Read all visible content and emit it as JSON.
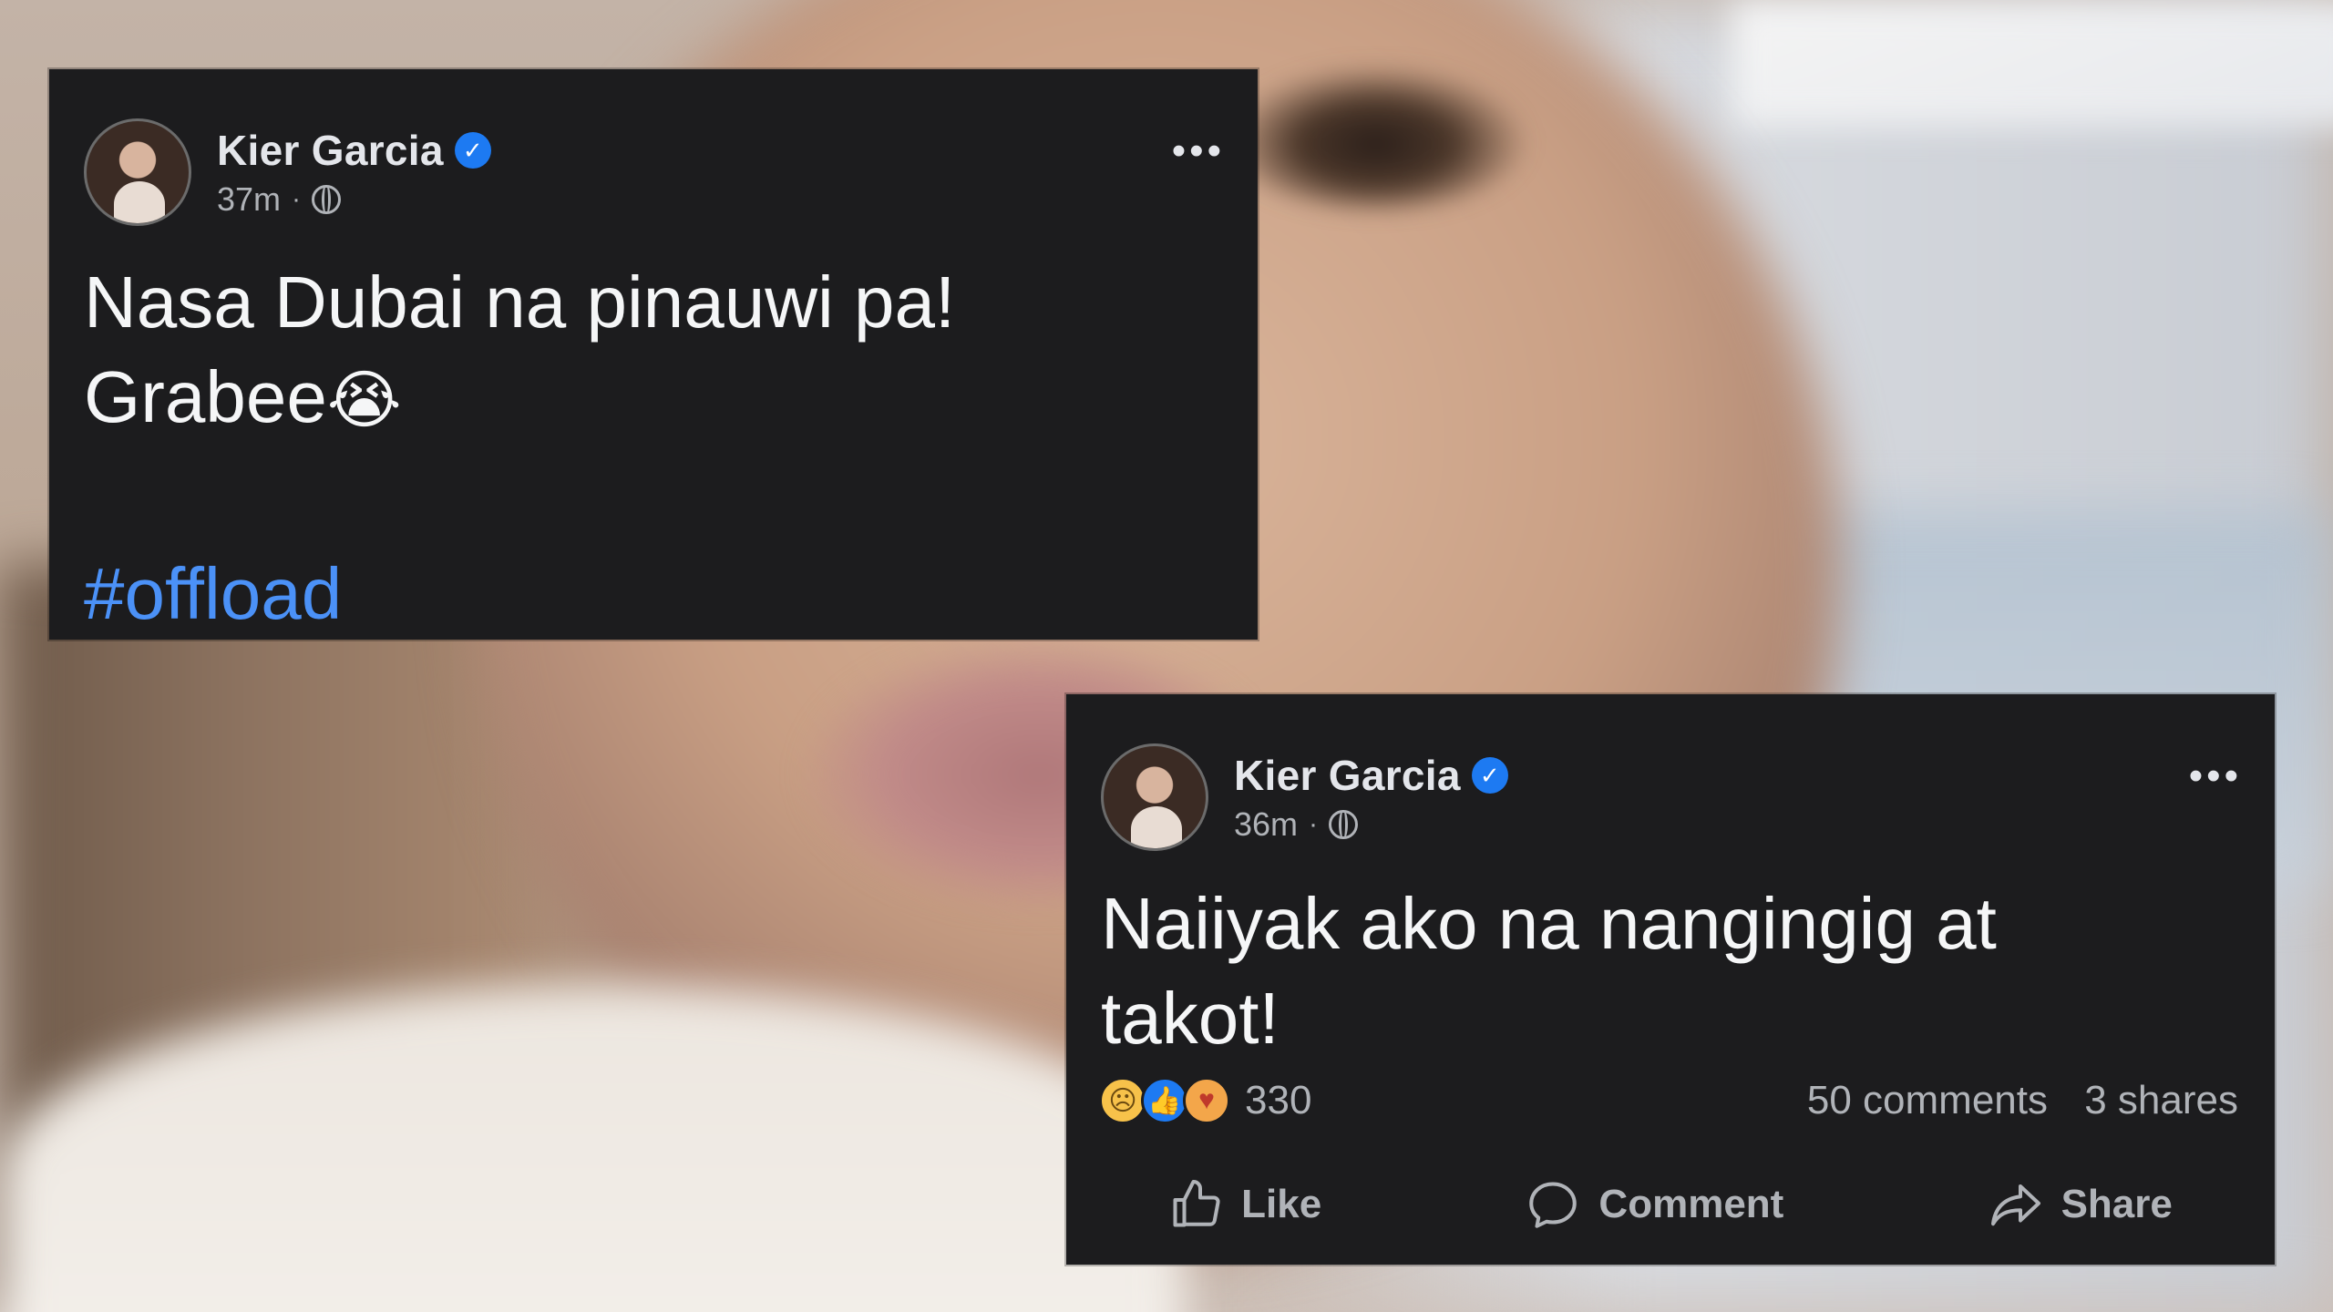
{
  "posts": [
    {
      "author": "Kier Garcia",
      "verified": true,
      "time": "37m",
      "privacy_icon": "globe-icon",
      "text_line1": "Nasa Dubai na pinauwi pa!",
      "text_line2": "Grabee",
      "emoji": "😭",
      "hashtag": "#offload"
    },
    {
      "author": "Kier Garcia",
      "verified": true,
      "time": "36m",
      "privacy_icon": "globe-icon",
      "text_line1": "Naiiyak ako na nangingig at",
      "text_line2": "takot!",
      "reactions": {
        "icons": [
          "sad-reaction-icon",
          "like-reaction-icon",
          "care-reaction-icon"
        ],
        "count": "330",
        "comments": "50 comments",
        "shares": "3 shares"
      },
      "actions": {
        "like": "Like",
        "comment": "Comment",
        "share": "Share"
      }
    }
  ],
  "colors": {
    "card_bg": "#1c1c1e",
    "text": "#e4e6eb",
    "muted": "#b0b3b8",
    "link": "#4b91f7",
    "verified": "#1d7af2"
  }
}
